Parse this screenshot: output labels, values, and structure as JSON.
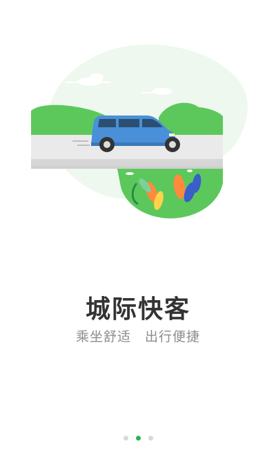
{
  "onboarding": {
    "title": "城际快客",
    "subtitle": "乘坐舒适　出行便捷",
    "page_indicator": {
      "total": 3,
      "current": 2
    }
  },
  "colors": {
    "accent_green": "#2bb24c",
    "car_blue": "#4a90d9",
    "blob_bg": "#eef8ee",
    "hill_green": "#5cc85c",
    "dot_inactive": "#d8d8d8"
  },
  "illustration": {
    "icon": "blue-minivan-on-road-illustration"
  }
}
